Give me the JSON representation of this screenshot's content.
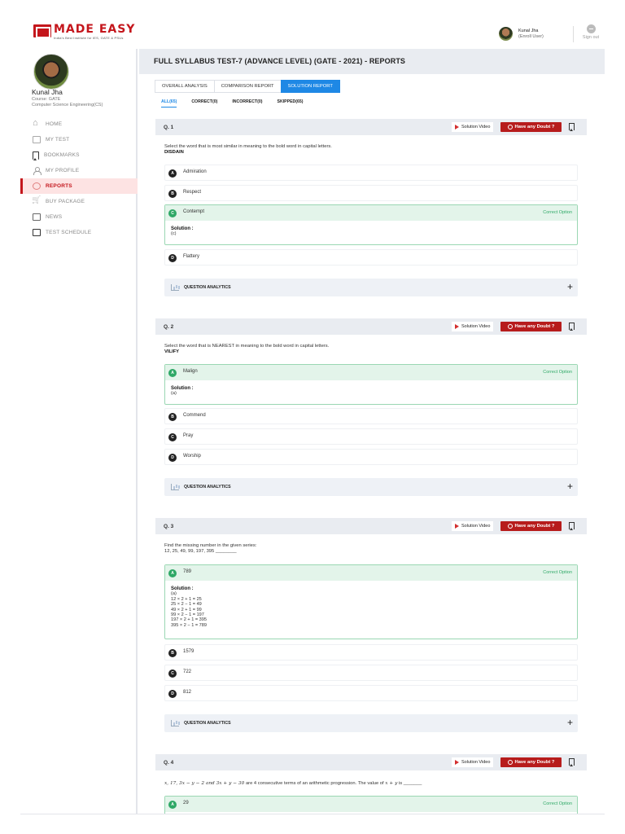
{
  "brand": {
    "name": "MADE EASY",
    "tagline": "India's Best Institute for IES, GATE & PSUs"
  },
  "user": {
    "name": "Kunal Jha",
    "role": "(Enroll User)",
    "signout": "Sign out",
    "course_line1": "Course: GATE",
    "course_line2": "Computer Science Engineering(CS)"
  },
  "nav": [
    {
      "label": "HOME",
      "icon": "home-icon"
    },
    {
      "label": "MY TEST",
      "icon": "test-icon"
    },
    {
      "label": "BOOKMARKS",
      "icon": "bookmark-icon"
    },
    {
      "label": "MY PROFILE",
      "icon": "profile-icon"
    },
    {
      "label": "REPORTS",
      "icon": "reports-icon",
      "active": true
    },
    {
      "label": "BUY PACKAGE",
      "icon": "cart-icon"
    },
    {
      "label": "NEWS",
      "icon": "news-icon"
    },
    {
      "label": "TEST SCHEDULE",
      "icon": "schedule-icon"
    }
  ],
  "page": {
    "title": "FULL SYLLABUS TEST-7 (ADVANCE LEVEL) (GATE - 2021) - REPORTS"
  },
  "tabs": [
    "OVERALL ANALYSIS",
    "COMPARISON REPORT",
    "SOLUTION REPORT"
  ],
  "subtabs": [
    "ALL(65)",
    "CORRECT(0)",
    "INCORRECT(0)",
    "SKIPPED(65)"
  ],
  "common": {
    "solution_video": "Solution Video",
    "doubt": "Have any Doubt ?",
    "correct_option": "Correct Option",
    "solution_label": "Solution :",
    "analytics": "QUESTION ANALYTICS",
    "plus": "+"
  },
  "questions": [
    {
      "num": "Q. 1",
      "text": "Select the word that is most similar in meaning to the bold word in capital letters.",
      "bold": "DISDAIN",
      "options": [
        {
          "letter": "A",
          "text": "Admiration"
        },
        {
          "letter": "B",
          "text": "Respect"
        },
        {
          "letter": "C",
          "text": "Contempt",
          "correct": true
        },
        {
          "letter": "D",
          "text": "Flattery"
        }
      ],
      "solution": [
        "(c)"
      ]
    },
    {
      "num": "Q. 2",
      "text": "Select the word that is NEAREST in meaning to the bold word in capital letters.",
      "bold": "VILIFY",
      "options": [
        {
          "letter": "A",
          "text": "Malign",
          "correct": true
        },
        {
          "letter": "B",
          "text": "Commend"
        },
        {
          "letter": "C",
          "text": "Pray"
        },
        {
          "letter": "D",
          "text": "Worship"
        }
      ],
      "solution": [
        "(a)"
      ]
    },
    {
      "num": "Q. 3",
      "text": "Find the missing number in the given series:",
      "text2": "12, 25, 49, 99, 197, 395 ________",
      "options": [
        {
          "letter": "A",
          "text": "789",
          "correct": true
        },
        {
          "letter": "B",
          "text": "1579"
        },
        {
          "letter": "C",
          "text": "722"
        },
        {
          "letter": "D",
          "text": "812"
        }
      ],
      "solution": [
        "(a)",
        "12 × 2 + 1 = 25",
        "25 × 2 − 1 = 49",
        "49 × 2 + 1 = 99",
        "99 × 2 − 1 = 197",
        "197 × 2 + 1 = 395",
        "395 × 2 − 1 = 789"
      ]
    },
    {
      "num": "Q. 4",
      "math": "x, 17, 3x − y − 2 and 3x + y − 30",
      "text": "are 4 consecutive terms of an arithmetic progression. The value of",
      "math2": "x + y",
      "text_end": "is _______",
      "options": [
        {
          "letter": "A",
          "text": "29",
          "correct": true
        }
      ]
    }
  ]
}
